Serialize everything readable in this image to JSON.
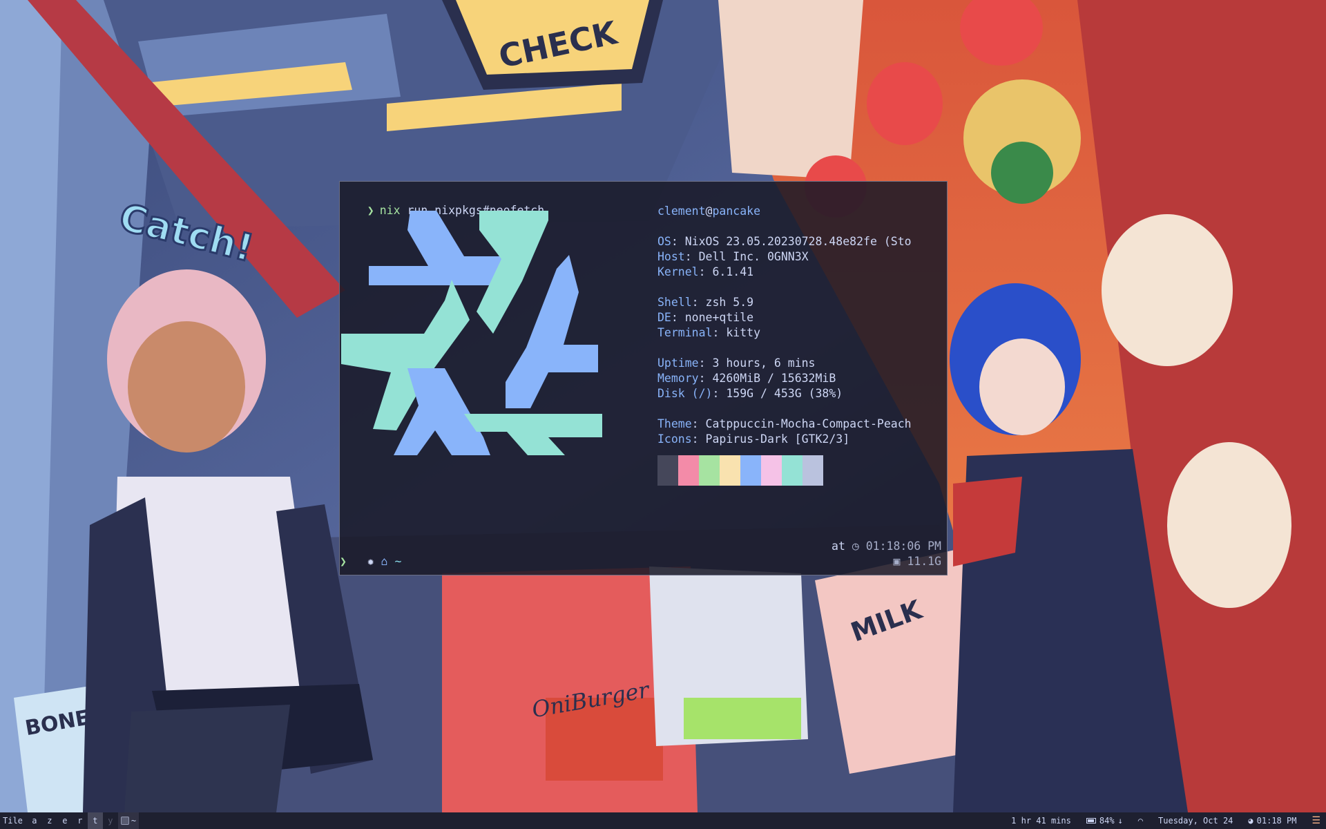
{
  "terminal": {
    "command_prefix": "nix",
    "command_rest": "run nixpkgs#neofetch",
    "user": "clement",
    "host": "pancake",
    "info": [
      {
        "key": "OS",
        "value": "NixOS 23.05.20230728.48e82fe (Sto"
      },
      {
        "key": "Host",
        "value": "Dell Inc. 0GNN3X"
      },
      {
        "key": "Kernel",
        "value": "6.1.41"
      },
      {
        "key": "Shell",
        "value": "zsh 5.9"
      },
      {
        "key": "DE",
        "value": "none+qtile"
      },
      {
        "key": "Terminal",
        "value": "kitty"
      },
      {
        "key": "Uptime",
        "value": "3 hours, 6 mins"
      },
      {
        "key": "Memory",
        "value": "4260MiB / 15632MiB"
      },
      {
        "key": "Disk (/)",
        "value": "159G / 453G (38%)"
      },
      {
        "key": "Theme",
        "value": "Catppuccin-Mocha-Compact-Peach"
      },
      {
        "key": "Icons",
        "value": "Papirus-Dark [GTK2/3]"
      }
    ],
    "palette": [
      "#45475a",
      "#f38ba8",
      "#a6e3a1",
      "#f9e2af",
      "#89b4fa",
      "#f5c2e7",
      "#94e2d5",
      "#bac2de"
    ],
    "logo_colors": {
      "primary": "#89b4fa",
      "secondary": "#94e2d5"
    },
    "prompt_dir": "~",
    "prompt_at": "at",
    "prompt_time": "01:18:06 PM",
    "prompt_mem": "11.1G",
    "prompt_symbol": "❯"
  },
  "bar": {
    "layout": "Tile",
    "groups": [
      {
        "label": "a",
        "state": "normal"
      },
      {
        "label": "z",
        "state": "normal"
      },
      {
        "label": "e",
        "state": "normal"
      },
      {
        "label": "r",
        "state": "normal"
      },
      {
        "label": "t",
        "state": "active"
      },
      {
        "label": "y",
        "state": "empty"
      }
    ],
    "task_label": "~",
    "uptime": "1 hr 41 mins",
    "battery": "84%",
    "date": "Tuesday, Oct 24",
    "time": "01:18 PM",
    "accent": "#fab387"
  },
  "wallpaper": {
    "signs": [
      "CHECK",
      "Catch!",
      "MILK",
      "BONES",
      "OniBurger"
    ]
  }
}
